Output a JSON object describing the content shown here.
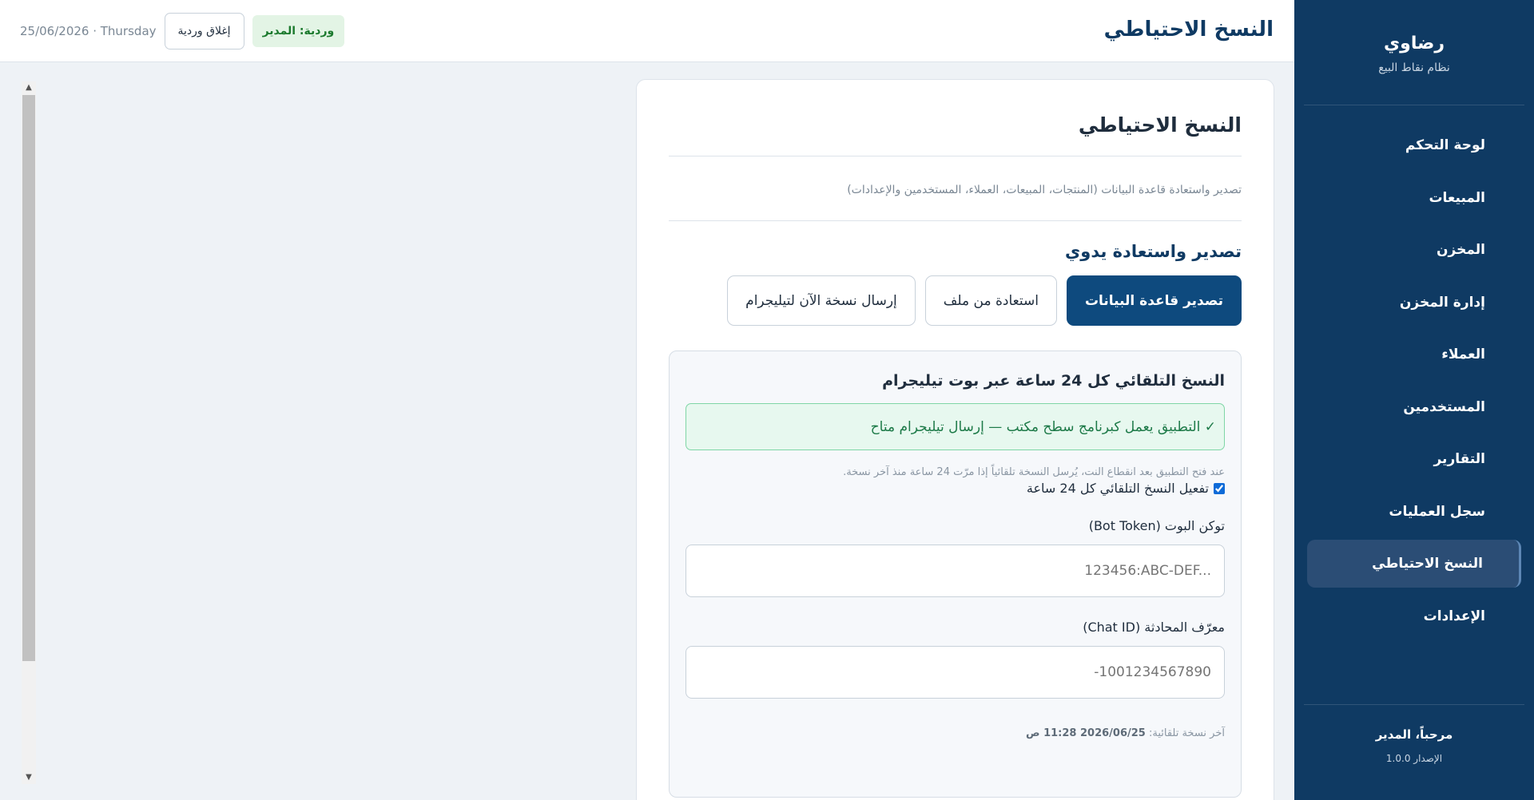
{
  "sidebar": {
    "brand_name": "رضاوي",
    "brand_sub": "نظام نقاط البيع",
    "items": [
      {
        "label": "لوحة التحكم"
      },
      {
        "label": "المبيعات"
      },
      {
        "label": "المخزن"
      },
      {
        "label": "إدارة المخزن"
      },
      {
        "label": "العملاء"
      },
      {
        "label": "المستخدمين"
      },
      {
        "label": "التقارير"
      },
      {
        "label": "سجل العمليات"
      },
      {
        "label": "النسخ الاحتياطي"
      },
      {
        "label": "الإعدادات"
      }
    ],
    "welcome": "مرحباً، المدير",
    "version": "الإصدار 1.0.0"
  },
  "header": {
    "title": "النسخ الاحتياطي",
    "shift_badge": "وردية: المدير",
    "close_shift": "إغلاق وردية",
    "date": "25/06/2026 · Thursday"
  },
  "card": {
    "title": "النسخ الاحتياطي",
    "description": "تصدير واستعادة قاعدة البيانات (المنتجات، المبيعات، العملاء، المستخدمين والإعدادات)",
    "manual_title": "تصدير واستعادة يدوي",
    "buttons": {
      "export": "تصدير قاعدة البيانات",
      "restore": "استعادة من ملف",
      "send_telegram": "إرسال نسخة الآن لتيليجرام"
    }
  },
  "auto": {
    "title": "النسخ التلقائي كل 24 ساعة عبر بوت تيليجرام",
    "status": "✓ التطبيق يعمل كبرنامج سطح مكتب — إرسال تيليجرام متاح",
    "hint": "عند فتح التطبيق بعد انقطاع النت، يُرسل النسخة تلقائياً إذا مرّت 24 ساعة منذ آخر نسخة.",
    "checkbox_label": "تفعيل النسخ التلقائي كل 24 ساعة",
    "checkbox_checked": true,
    "token_label": "توكن البوت (Bot Token)",
    "token_placeholder": "123456:ABC-DEF...",
    "chat_label": "معرّف المحادثة (Chat ID)",
    "chat_placeholder": "-1001234567890",
    "last_backup_label": "آخر نسخة تلقائية:",
    "last_backup_value": "2026/06/25 11:28 ص"
  },
  "colors": {
    "sidebar_bg": "#0f3a63",
    "primary": "#0e4a7e",
    "success": "#1d7a48"
  }
}
